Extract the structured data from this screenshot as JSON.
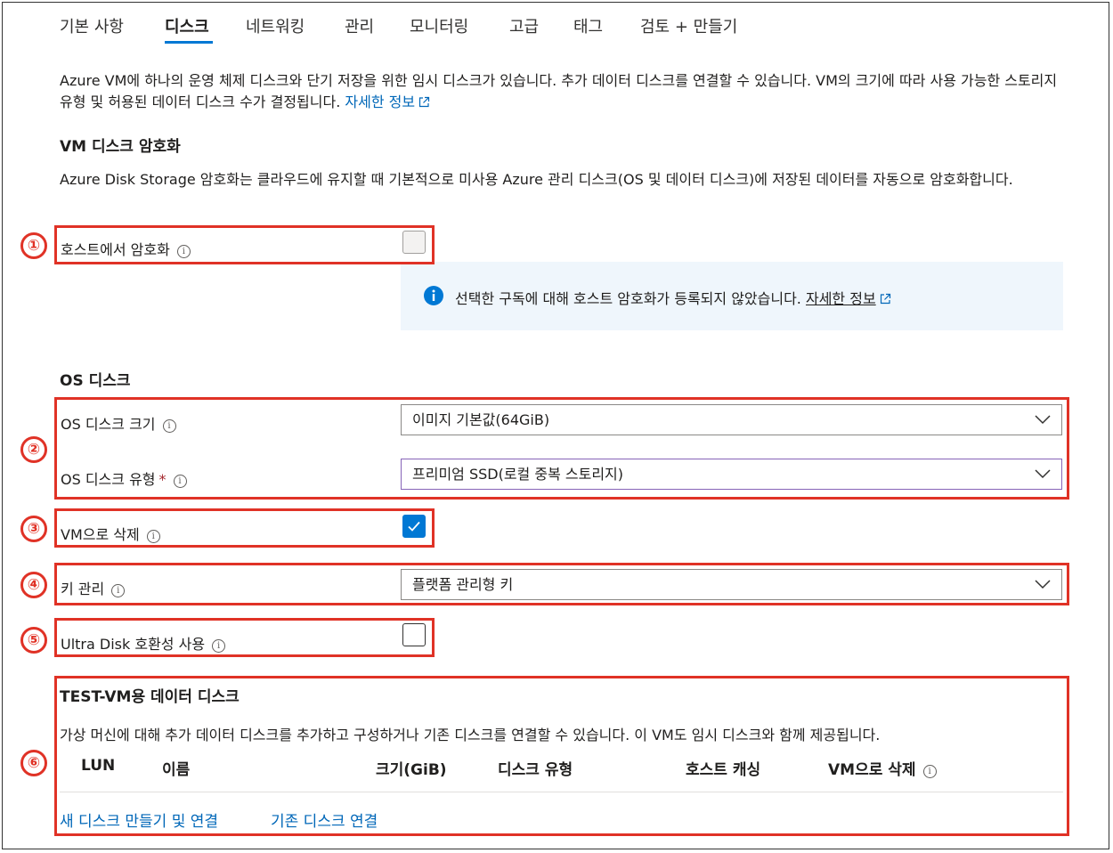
{
  "tabs": [
    "기본 사항",
    "디스크",
    "네트워킹",
    "관리",
    "모니터링",
    "고급",
    "태그",
    "검토 + 만들기"
  ],
  "intro": {
    "text": "Azure VM에 하나의 운영 체제 디스크와 단기 저장을 위한 임시 디스크가 있습니다. 추가 데이터 디스크를 연결할 수 있습니다. VM의 크기에 따라 사용 가능한 스토리지 유형 및 허용된 데이터 디스크 수가 결정됩니다.",
    "link": "자세한 정보"
  },
  "encryption": {
    "title": "VM 디스크 암호화",
    "description": "Azure Disk Storage 암호화는 클라우드에 유지할 때 기본적으로 미사용 Azure 관리 디스크(OS 및 데이터 디스크)에 저장된 데이터를 자동으로 암호화합니다.",
    "host_label": "호스트에서 암호화",
    "host_checked": false,
    "info_message": "선택한 구독에 대해 호스트 암호화가 등록되지 않았습니다.",
    "info_link": "자세한 정보"
  },
  "os_disk": {
    "title": "OS 디스크",
    "size_label": "OS 디스크 크기",
    "size_value": "이미지 기본값(64GiB)",
    "type_label": "OS 디스크 유형",
    "type_required": "*",
    "type_value": "프리미엄 SSD(로컬 중복 스토리지)",
    "delete_label": "VM으로 삭제",
    "delete_checked": true,
    "key_label": "키 관리",
    "key_value": "플랫폼 관리형 키",
    "ultra_label": "Ultra Disk 호환성 사용",
    "ultra_checked": false
  },
  "data_disks": {
    "title": "TEST-VM용 데이터 디스크",
    "description": "가상 머신에 대해 추가 데이터 디스크를 추가하고 구성하거나 기존 디스크를 연결할 수 있습니다. 이 VM도 임시 디스크와 함께 제공됩니다.",
    "columns": [
      "LUN",
      "이름",
      "크기(GiB)",
      "디스크 유형",
      "호스트 캐싱",
      "VM으로 삭제"
    ],
    "create_link": "새 디스크 만들기 및 연결",
    "attach_link": "기존 디스크 연결"
  },
  "markers": [
    "①",
    "②",
    "③",
    "④",
    "⑤",
    "⑥"
  ],
  "colors": {
    "accent": "#0078d4",
    "annotation": "#e03226",
    "link": "#0067b8",
    "info_bg": "#eff6fc"
  }
}
